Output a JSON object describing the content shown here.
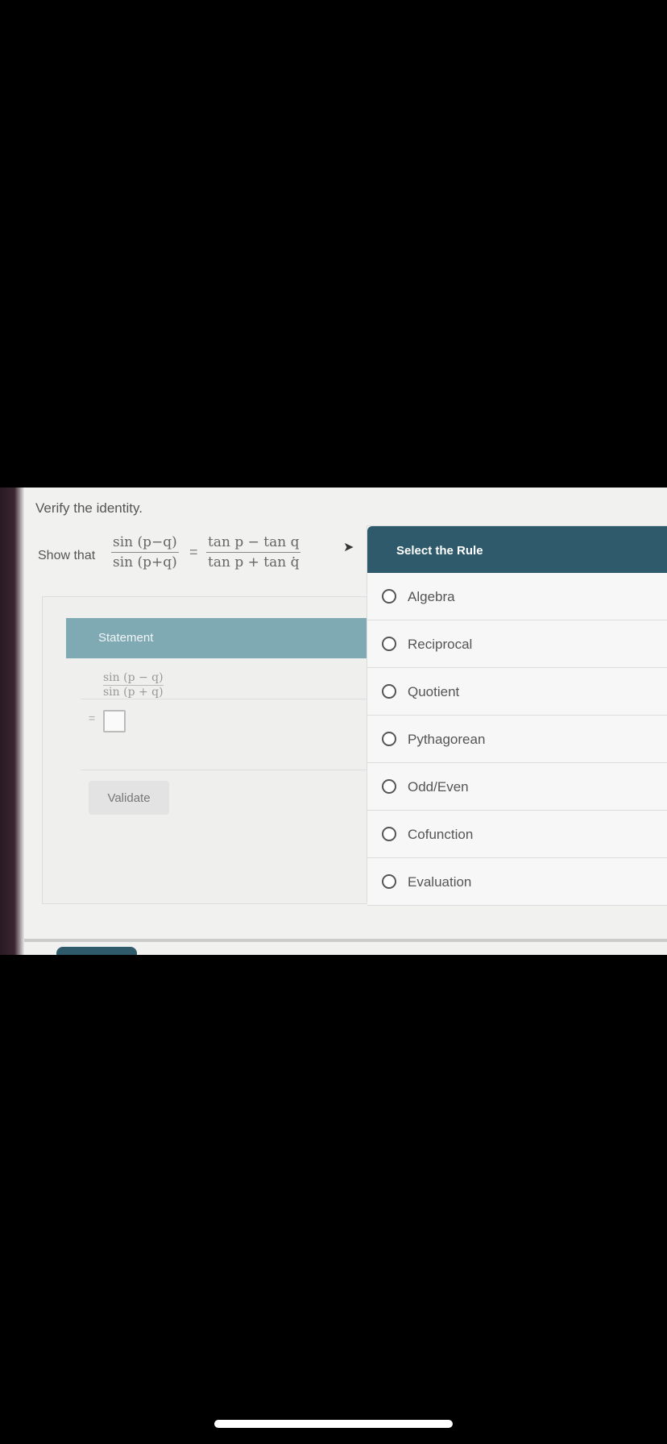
{
  "prompt": "Verify the identity.",
  "show_that": {
    "label": "Show that",
    "lhs_num": "sin (p−q)",
    "lhs_den": "sin (p+q)",
    "equals": "=",
    "rhs_num": "tan p − tan q",
    "rhs_den": "tan p + tan q",
    "period": "."
  },
  "work": {
    "statement_header": "Statement",
    "expr_num": "sin (p − q)",
    "expr_den": "sin (p + q)",
    "equals": "=",
    "validate_label": "Validate"
  },
  "rule_panel": {
    "header": "Select the Rule",
    "options": [
      "Algebra",
      "Reciprocal",
      "Quotient",
      "Pythagorean",
      "Odd/Even",
      "Cofunction",
      "Evaluation"
    ]
  }
}
